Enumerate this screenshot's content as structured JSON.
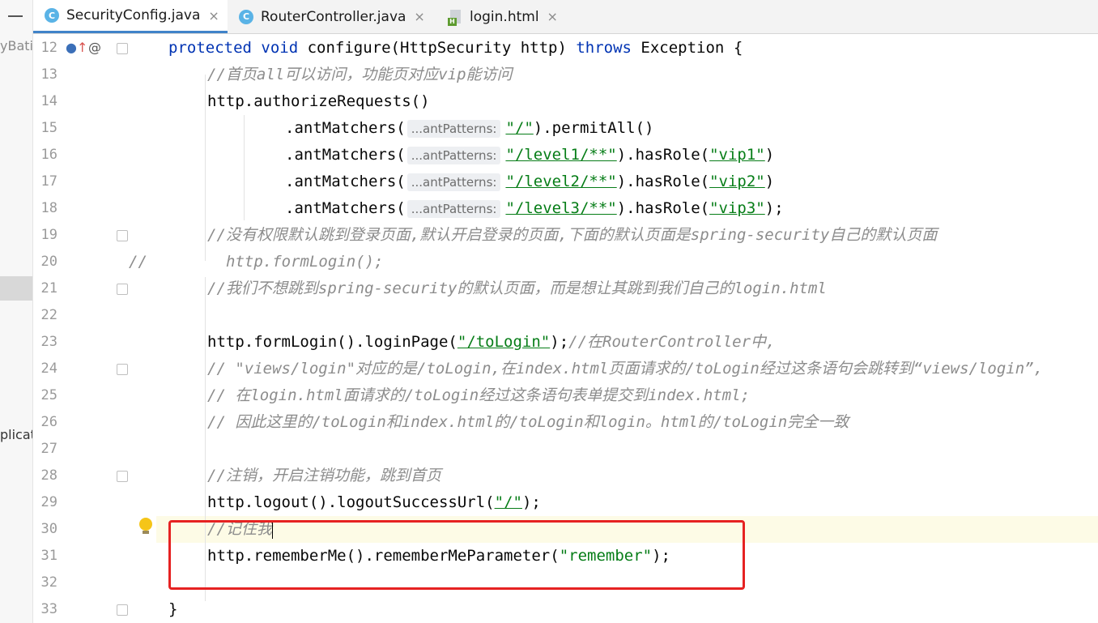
{
  "left_panel": {
    "fragment_top": "yBatis",
    "fragment_mid": "plicat"
  },
  "tabs": [
    {
      "label": "SecurityConfig.java",
      "icon": "class-icon",
      "active": true
    },
    {
      "label": "RouterController.java",
      "icon": "class-icon",
      "active": false
    },
    {
      "label": "login.html",
      "icon": "html-file-icon",
      "active": false
    }
  ],
  "tab_icon_letters": {
    "class": "C",
    "html": "H"
  },
  "close_glyph": "×",
  "gutter": {
    "line_numbers": [
      "12",
      "13",
      "14",
      "15",
      "16",
      "17",
      "18",
      "19",
      "20",
      "21",
      "22",
      "23",
      "24",
      "25",
      "26",
      "27",
      "28",
      "29",
      "30",
      "31",
      "32",
      "33"
    ],
    "override_marker": "↑",
    "at_marker": "@"
  },
  "code": {
    "l12": {
      "kw1": "protected",
      "kw2": "void",
      "rest": " configure(HttpSecurity http) ",
      "kw3": "throws",
      "tail": " Exception {"
    },
    "l13": "//首页all可以访问，功能页对应vip能访问",
    "l14": "http.authorizeRequests()",
    "hint": "...antPatterns:",
    "l15": {
      "pre": ".antMatchers(",
      "s": "\"/\"",
      "post": ").permitAll()"
    },
    "l16": {
      "pre": ".antMatchers(",
      "s": "\"/level1/**\"",
      "mid": ").hasRole(",
      "r": "\"vip1\"",
      "post": ")"
    },
    "l17": {
      "pre": ".antMatchers(",
      "s": "\"/level2/**\"",
      "mid": ").hasRole(",
      "r": "\"vip2\"",
      "post": ")"
    },
    "l18": {
      "pre": ".antMatchers(",
      "s": "\"/level3/**\"",
      "mid": ").hasRole(",
      "r": "\"vip3\"",
      "post": ");"
    },
    "l19": "//没有权限默认跳到登录页面,默认开启登录的页面,下面的默认页面是spring-security自己的默认页面",
    "l20_prefix": "//",
    "l20": "http.formLogin();",
    "l21": "//我们不想跳到spring-security的默认页面，而是想让其跳到我们自己的login.html",
    "l23": {
      "pre": "http.formLogin().loginPage(",
      "s": "\"/toLogin\"",
      "post": ");",
      "cm": "//在RouterController中,"
    },
    "l24": "// \"views/login\"对应的是/toLogin,在index.html页面请求的/toLogin经过这条语句会跳转到“views/login”,",
    "l25": "// 在login.html面请求的/toLogin经过这条语句表单提交到index.html;",
    "l26": "// 因此这里的/toLogin和index.html的/toLogin和login。html的/toLogin完全一致",
    "l28": "//注销，开启注销功能，跳到首页",
    "l29": {
      "pre": "http.logout().logoutSuccessUrl(",
      "s": "\"/\"",
      "post": ");"
    },
    "l30": "//记住我",
    "l31": {
      "pre": "http.rememberMe().rememberMeParameter(",
      "s": "\"remember\"",
      "post": ");"
    },
    "l33": "}"
  },
  "colors": {
    "keyword": "#0033b3",
    "string": "#067d17",
    "comment": "#8c8c8c",
    "highlight_box": "#e62222",
    "tab_underline": "#4083c9"
  }
}
